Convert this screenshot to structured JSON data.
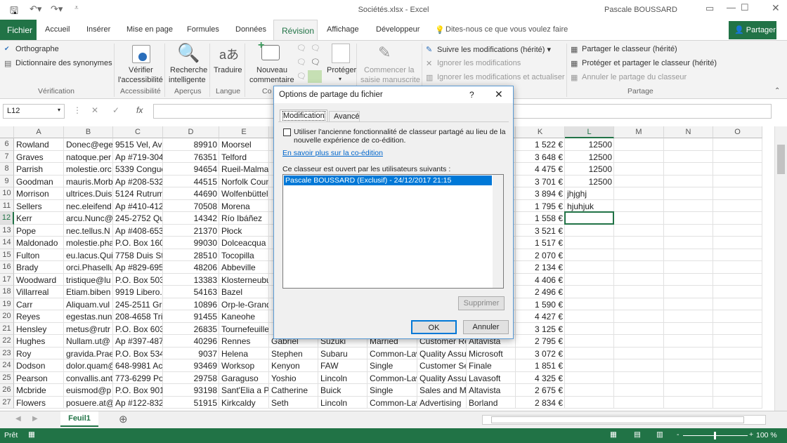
{
  "window": {
    "title": "Sociétés.xlsx  -  Excel",
    "user": "Pascale BOUSSARD"
  },
  "tabs": [
    "Fichier",
    "Accueil",
    "Insérer",
    "Mise en page",
    "Formules",
    "Données",
    "Révision",
    "Affichage",
    "Développeur"
  ],
  "tell_me": "Dites-nous ce que vous voulez faire",
  "share_label": "Partager",
  "ribbon": {
    "orthographe": "Orthographe",
    "synonymes": "Dictionnaire des synonymes",
    "verification": "Vérification",
    "verifier1": "Vérifier",
    "verifier2": "l'accessibilité",
    "accessibilite": "Accessibilité",
    "recherche1": "Recherche",
    "recherche2": "intelligente",
    "apercus": "Aperçus",
    "traduire": "Traduire",
    "langue": "Langue",
    "nouveau1": "Nouveau",
    "nouveau2": "commentaire",
    "commentaires": "Co",
    "proteger": "Protéger",
    "manuscrite1": "Commencer la",
    "manuscrite2": "saisie manuscrite",
    "suivre": "Suivre les modifications (hérité) ▾",
    "ignorer": "Ignorer les modifications",
    "ignorer_act": "Ignorer les modifications et actualiser",
    "partager_classeur": "Partager le classeur (hérité)",
    "proteger_partager": "Protéger et partager le classeur (hérité)",
    "annuler_partage": "Annuler le partage du classeur",
    "partage": "Partage"
  },
  "formula": {
    "namebox": "L12",
    "value": ""
  },
  "columns": [
    "A",
    "B",
    "C",
    "D",
    "E",
    "F",
    "G",
    "H",
    "I",
    "J",
    "K",
    "L",
    "M",
    "N",
    "O"
  ],
  "rows": [
    {
      "n": "6",
      "cells": [
        "Rowland",
        "Donec@eget",
        "9515 Vel, Ave",
        "89910",
        "Moorsel",
        "",
        "",
        "",
        "",
        "",
        "1 522 €",
        "12500"
      ]
    },
    {
      "n": "7",
      "cells": [
        "Graves",
        "natoque.per",
        "Ap #719-3048",
        "76351",
        "Telford",
        "",
        "",
        "",
        "",
        "",
        "3 648 €",
        "12500"
      ]
    },
    {
      "n": "8",
      "cells": [
        "Parrish",
        "molestie.orc",
        "5339 Congue",
        "94654",
        "Rueil-Malmaison",
        "",
        "",
        "",
        "",
        "",
        "4 475 €",
        "12500"
      ]
    },
    {
      "n": "9",
      "cells": [
        "Goodman",
        "mauris.Morb",
        "Ap #208-5325",
        "44515",
        "Norfolk County",
        "",
        "",
        "",
        "",
        "",
        "3 701 €",
        "12500"
      ]
    },
    {
      "n": "10",
      "cells": [
        "Morrison",
        "ultrices.Duis",
        "5124 Rutrum",
        "44690",
        "Wolfenbüttel",
        "",
        "",
        "",
        "",
        "",
        "3 894 €",
        "jhjghj"
      ]
    },
    {
      "n": "11",
      "cells": [
        "Sellers",
        "nec.eleifend",
        "Ap #410-4125",
        "70508",
        "Morena",
        "",
        "",
        "",
        "",
        "",
        "1 795 €",
        "hjuhjuk"
      ]
    },
    {
      "n": "12",
      "cells": [
        "Kerr",
        "arcu.Nunc@",
        "245-2752 Qui",
        "14342",
        "Río Ibáñez",
        "",
        "",
        "",
        "",
        "",
        "1 558 €",
        ""
      ]
    },
    {
      "n": "13",
      "cells": [
        "Pope",
        "nec.tellus.N",
        "Ap #408-6537",
        "21370",
        "Płock",
        "",
        "",
        "",
        "",
        "",
        "3 521 €",
        ""
      ]
    },
    {
      "n": "14",
      "cells": [
        "Maldonado",
        "molestie.pha",
        "P.O. Box 160",
        "99030",
        "Dolceacqua",
        "",
        "",
        "",
        "",
        "",
        "1 517 €",
        ""
      ]
    },
    {
      "n": "15",
      "cells": [
        "Fulton",
        "eu.lacus.Qui",
        "7758 Duis St.",
        "28510",
        "Tocopilla",
        "",
        "",
        "",
        "",
        "",
        "2 070 €",
        ""
      ]
    },
    {
      "n": "16",
      "cells": [
        "Brady",
        "orci.Phasellu",
        "Ap #829-6951",
        "48206",
        "Abbeville",
        "",
        "",
        "",
        "",
        "",
        "2 134 €",
        ""
      ]
    },
    {
      "n": "17",
      "cells": [
        "Woodward",
        "tristique@lu",
        "P.O. Box 503",
        "13383",
        "Klosterneuburg",
        "",
        "",
        "",
        "",
        "",
        "4 406 €",
        ""
      ]
    },
    {
      "n": "18",
      "cells": [
        "Villarreal",
        "Etiam.biben",
        "9919 Libero.",
        "54163",
        "Bazel",
        "",
        "",
        "",
        "",
        "",
        "2 496 €",
        ""
      ]
    },
    {
      "n": "19",
      "cells": [
        "Carr",
        "Aliquam.vul",
        "245-2511 Gra",
        "10896",
        "Orp-le-Grand",
        "",
        "",
        "",
        "",
        "",
        "1 590 €",
        ""
      ]
    },
    {
      "n": "20",
      "cells": [
        "Reyes",
        "egestas.nun",
        "208-4658 Tris",
        "91455",
        "Kaneohe",
        "",
        "",
        "",
        "",
        "",
        "4 427 €",
        ""
      ]
    },
    {
      "n": "21",
      "cells": [
        "Hensley",
        "metus@rutr",
        "P.O. Box 603",
        "26835",
        "Tournefeuille",
        "",
        "",
        "",
        "",
        "",
        "3 125 €",
        ""
      ]
    },
    {
      "n": "22",
      "cells": [
        "Hughes",
        "Nullam.ut@",
        "Ap #397-4871",
        "40296",
        "Rennes",
        "Gabriel",
        "Suzuki",
        "Married",
        "Customer Re",
        "Altavista",
        "2 795 €",
        ""
      ]
    },
    {
      "n": "23",
      "cells": [
        "Roy",
        "gravida.Prae",
        "P.O. Box 534",
        "9037",
        "Helena",
        "Stephen",
        "Subaru",
        "Common-Law",
        "Quality Assu",
        "Microsoft",
        "3 072 €",
        ""
      ]
    },
    {
      "n": "24",
      "cells": [
        "Dodson",
        "dolor.quam@",
        "648-9981 Acc",
        "93469",
        "Worksop",
        "Kenyon",
        "FAW",
        "Single",
        "Customer Se",
        "Finale",
        "1 851 €",
        ""
      ]
    },
    {
      "n": "25",
      "cells": [
        "Pearson",
        "convallis.ant",
        "773-6299 Pos",
        "29758",
        "Garaguso",
        "Yoshio",
        "Lincoln",
        "Common-Law",
        "Quality Assu",
        "Lavasoft",
        "4 325 €",
        ""
      ]
    },
    {
      "n": "26",
      "cells": [
        "Mcbride",
        "euismod@p",
        "P.O. Box 901",
        "93198",
        "Sant'Elia a Pianisi",
        "Catherine",
        "Buick",
        "Single",
        "Sales and Ma",
        "Altavista",
        "2 675 €",
        ""
      ]
    },
    {
      "n": "27",
      "cells": [
        "Flowers",
        "posuere.at@",
        "Ap #122-8329",
        "51915",
        "Kirkcaldy",
        "Seth",
        "Lincoln",
        "Common-Law",
        "Advertising",
        "Borland",
        "2 834 €",
        ""
      ]
    }
  ],
  "sheet": {
    "tab": "Feuil1"
  },
  "status": {
    "ready": "Prêt",
    "zoom": "100 %",
    "zoom_level_percent": 100
  },
  "dialog": {
    "title": "Options de partage du fichier",
    "help": "?",
    "tabs": [
      "Modification",
      "Avancé"
    ],
    "checkbox_line1": "Utiliser l'ancienne fonctionnalité de classeur partagé au lieu de la",
    "checkbox_line2": "nouvelle expérience de co-édition.",
    "checkbox_checked": false,
    "link": "En savoir plus sur la co-édition",
    "users_label": "Ce classeur est ouvert par les utilisateurs suivants :",
    "users": [
      "Pascale BOUSSARD (Exclusif) - 24/12/2017 21:15"
    ],
    "remove": "Supprimer",
    "ok": "OK",
    "cancel": "Annuler"
  },
  "colors": {
    "accent": "#217346",
    "selection": "#0078d7"
  }
}
